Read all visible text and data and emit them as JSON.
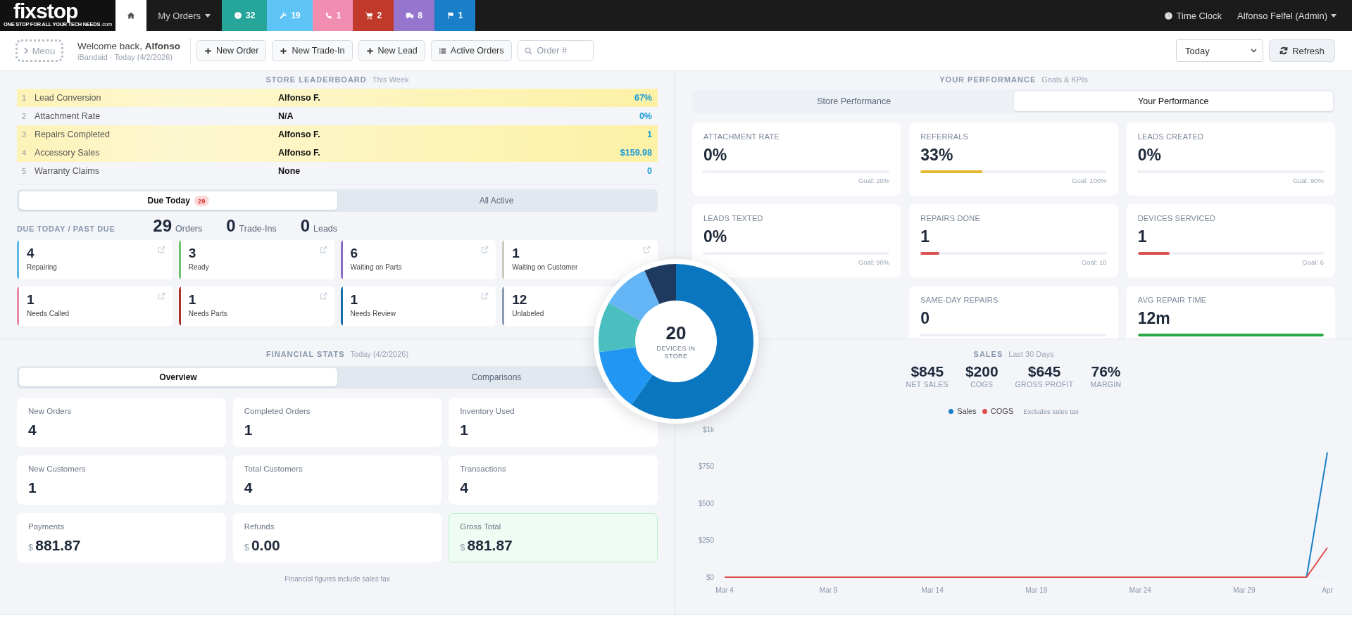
{
  "nav": {
    "logo": "fixstop",
    "tagline": "ONE STOP FOR ALL YOUR TECH NEEDS",
    "logo_suffix": ".com",
    "tabs": [
      {
        "kind": "home",
        "selected": true
      },
      {
        "kind": "menu",
        "label": "My Orders",
        "selected": false
      }
    ],
    "badges": [
      {
        "kind": "clock",
        "count": "32",
        "color": "#26a69a"
      },
      {
        "kind": "wrench",
        "count": "19",
        "color": "#5ec3f5"
      },
      {
        "kind": "phone",
        "count": "1",
        "color": "#f28db2"
      },
      {
        "kind": "cart",
        "count": "2",
        "color": "#c0392b"
      },
      {
        "kind": "truck",
        "count": "8",
        "color": "#9575cd"
      },
      {
        "kind": "flag",
        "count": "1",
        "color": "#1a7fc9"
      }
    ],
    "time_clock": "Time Clock",
    "user": "Alfonso Felfel (Admin)"
  },
  "header": {
    "menu_button": "Menu",
    "welcome": "Welcome back, **Alfonso**",
    "subtitle": "iBandaid · Today (4/2/2026)",
    "actions": [
      {
        "kind": "plus",
        "label": "New Order"
      },
      {
        "kind": "plus",
        "label": "New Trade-In"
      },
      {
        "kind": "plus",
        "label": "New Lead"
      },
      {
        "kind": "list",
        "label": "Active Orders"
      }
    ],
    "search": {
      "placeholder": "Order #"
    },
    "range": "Today",
    "refresh": "Refresh"
  },
  "leaderboard": {
    "title": "STORE LEADERBOARD",
    "subtitle": "This Week",
    "rows": [
      {
        "rank": "1",
        "metric": "Lead Conversion",
        "leader": "Alfonso F.",
        "value": "67%",
        "highlighted": true
      },
      {
        "rank": "2",
        "metric": "Attachment Rate",
        "leader": "N/A",
        "value": "0%",
        "highlighted": false
      },
      {
        "rank": "3",
        "metric": "Repairs Completed",
        "leader": "Alfonso F.",
        "value": "1",
        "highlighted": true
      },
      {
        "rank": "4",
        "metric": "Accessory Sales",
        "leader": "Alfonso F.",
        "value": "$159.98",
        "highlighted": true
      },
      {
        "rank": "5",
        "metric": "Warranty Claims",
        "leader": "None",
        "value": "0",
        "highlighted": false
      }
    ]
  },
  "due": {
    "tabs": [
      {
        "label": "Due Today",
        "badge": "29",
        "selected": true
      },
      {
        "label": "All Active",
        "selected": false
      }
    ],
    "heading": "DUE TODAY / PAST DUE",
    "counts": [
      {
        "value": "29",
        "label": "Orders"
      },
      {
        "value": "0",
        "label": "Trade-Ins"
      },
      {
        "value": "0",
        "label": "Leads"
      }
    ],
    "statuses": [
      {
        "count": "4",
        "label": "Repairing",
        "color": "#5bb8e8",
        "link_icon": true
      },
      {
        "count": "3",
        "label": "Ready",
        "color": "#6cc070",
        "link_icon": true
      },
      {
        "count": "6",
        "label": "Waiting on Parts",
        "color": "#8e6bc2",
        "link_icon": true
      },
      {
        "count": "1",
        "label": "Waiting on Customer",
        "color": "#c9c9bd",
        "link_icon": true
      },
      {
        "count": "1",
        "label": "Needs Called",
        "color": "#e889a8",
        "link_icon": true
      },
      {
        "count": "1",
        "label": "Needs Parts",
        "color": "#a93226",
        "link_icon": true
      },
      {
        "count": "1",
        "label": "Needs Review",
        "color": "#1a6fa8",
        "link_icon": true
      },
      {
        "count": "12",
        "label": "Unlabeled",
        "color": "#8a9bb0",
        "link_icon": false
      }
    ]
  },
  "performance": {
    "title": "YOUR PERFORMANCE",
    "subtitle": "Goals & KPIs",
    "tabs": [
      {
        "label": "Store Performance",
        "selected": false
      },
      {
        "label": "Your Performance",
        "selected": true
      }
    ],
    "kpis": [
      {
        "label": "ATTACHMENT RATE",
        "value": "0%",
        "level": 0,
        "goal": "Goal: 20%"
      },
      {
        "label": "REFERRALS",
        "value": "33%",
        "level": 0.33,
        "goal": "Goal: 100%",
        "color": "#e6b92a"
      },
      {
        "label": "LEADS CREATED",
        "value": "0%",
        "level": 0,
        "goal": "Goal: 90%"
      },
      {
        "label": "LEADS TEXTED",
        "value": "0%",
        "level": 0,
        "goal": "Goal: 90%"
      },
      {
        "label": "REPAIRS DONE",
        "value": "1",
        "level": 0.1,
        "goal": "Goal: 10",
        "color": "#d9534f"
      },
      {
        "label": "DEVICES SERVICED",
        "value": "1",
        "level": 0.17,
        "goal": "Goal: 6",
        "color": "#d9534f"
      },
      {
        "label": "SAME-DAY REPAIRS",
        "value": "0",
        "level": 0
      },
      {
        "label": "AVG REPAIR TIME",
        "value": "12m",
        "level": 1,
        "color": "#28a745"
      }
    ]
  },
  "donut": {
    "value": "20",
    "label": "DEVICES IN STORE"
  },
  "financial": {
    "title": "FINANCIAL STATS",
    "subtitle": "Today (4/2/2026)",
    "tabs": [
      {
        "label": "Overview",
        "selected": true
      },
      {
        "label": "Comparisons",
        "selected": false
      }
    ],
    "cards": [
      {
        "label": "New Orders",
        "value": "4",
        "highlighted": false
      },
      {
        "label": "Completed Orders",
        "value": "1",
        "highlighted": false
      },
      {
        "label": "Inventory Used",
        "value": "1",
        "highlighted": false
      },
      {
        "label": "New Customers",
        "value": "1",
        "highlighted": false
      },
      {
        "label": "Total Customers",
        "value": "4",
        "highlighted": false
      },
      {
        "label": "Transactions",
        "value": "4",
        "highlighted": false
      },
      {
        "label": "Payments",
        "currency": "$",
        "value": "881.87",
        "highlighted": false
      },
      {
        "label": "Refunds",
        "currency": "$",
        "value": "0.00",
        "highlighted": false
      },
      {
        "label": "Gross Total",
        "currency": "$",
        "value": "881.87",
        "highlighted": true
      }
    ],
    "note": "Financial figures include sales tax"
  },
  "sales": {
    "title": "SALES",
    "subtitle": "Last 30 Days",
    "stats": [
      {
        "value": "$845",
        "label": "NET SALES"
      },
      {
        "value": "$200",
        "label": "COGS"
      },
      {
        "value": "$645",
        "label": "GROSS PROFIT"
      },
      {
        "value": "76%",
        "label": "MARGIN"
      }
    ],
    "note": "Excludes sales tax",
    "chart_data": {
      "type": "line",
      "categories": [
        "Mar 4",
        null,
        null,
        null,
        null,
        "Mar 9",
        null,
        null,
        null,
        null,
        "Mar 14",
        null,
        null,
        null,
        null,
        "Mar 19",
        null,
        null,
        null,
        null,
        "Mar 24",
        null,
        null,
        null,
        null,
        "Mar 29",
        null,
        null,
        null,
        "Apr"
      ],
      "series": [
        {
          "name": "Sales",
          "color": "#1a7fc9",
          "values": [
            null,
            null,
            null,
            null,
            null,
            null,
            null,
            null,
            null,
            null,
            null,
            null,
            null,
            null,
            null,
            null,
            null,
            null,
            null,
            null,
            null,
            null,
            null,
            null,
            null,
            null,
            null,
            null,
            0,
            845
          ]
        },
        {
          "name": "COGS",
          "color": "#e04b4b",
          "values": [
            0,
            0,
            0,
            0,
            0,
            0,
            0,
            0,
            0,
            0,
            0,
            0,
            0,
            0,
            0,
            0,
            0,
            0,
            0,
            0,
            0,
            0,
            0,
            0,
            0,
            0,
            0,
            0,
            0,
            200
          ]
        }
      ],
      "ylim": [
        0,
        1000
      ],
      "yticks": [
        {
          "value": 0,
          "label": "$0"
        },
        {
          "value": 250,
          "label": "$250"
        },
        {
          "value": 500,
          "label": "$500"
        },
        {
          "value": 750,
          "label": "$750"
        },
        {
          "value": 1000,
          "label": "$1k"
        }
      ]
    }
  }
}
